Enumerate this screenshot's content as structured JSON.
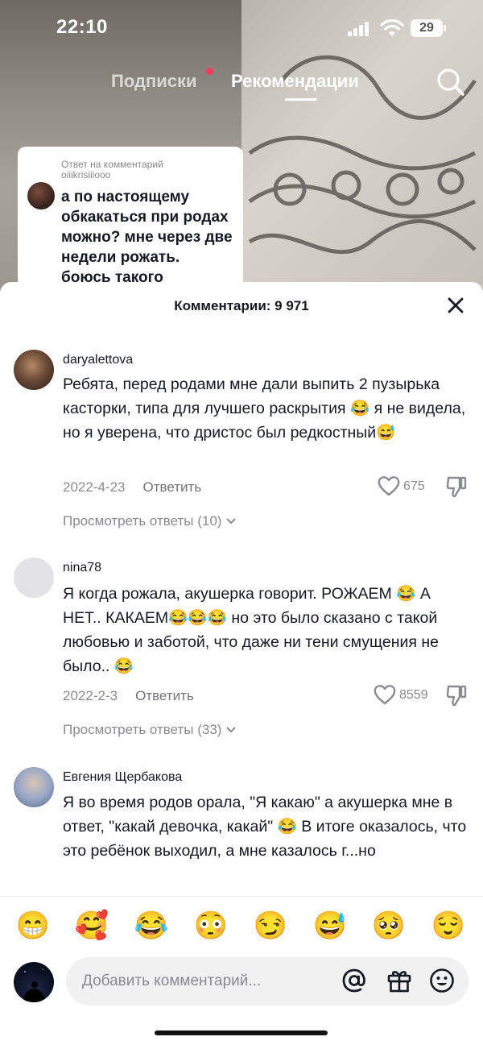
{
  "status_bar": {
    "time": "22:10",
    "battery": "29"
  },
  "top_nav": {
    "following": "Подписки",
    "for_you": "Рекомендации"
  },
  "reply_card": {
    "caption_line1": "Ответ на комментарий",
    "caption_line2": "oiiikrisiiiooo",
    "text": "а по настоящему обкакаться при родах можно? мне через две недели рожать. боюсь такого"
  },
  "sheet": {
    "title": "Комментарии: 9 971"
  },
  "comments": [
    {
      "username": "daryalettova",
      "text": "Ребята, перед родами мне дали выпить 2 пузырька касторки, типа для лучшего раскрытия 😂 я не видела, но я уверена, что дристос был редкостный😅",
      "date": "2022-4-23",
      "reply": "Ответить",
      "likes": "675",
      "view_replies": "Просмотреть ответы (10)"
    },
    {
      "username": "nina78",
      "text": "Я когда рожала, акушерка говорит. РОЖАЕМ 😂 А НЕТ.. КАКАЕМ😂😂😂 но это было сказано с такой любовью и заботой, что даже ни тени смущения не было.. 😂",
      "date": "2022-2-3",
      "reply": "Ответить",
      "likes": "8559",
      "view_replies": "Просмотреть ответы (33)"
    },
    {
      "username": "Евгения Щербакова",
      "text": "Я во время родов орала, \"Я какаю\" а акушерка мне в ответ, \"какай девочка, какай\" 😂 В итоге оказалось, что это ребёнок выходил, а мне казалось г...но"
    }
  ],
  "emoji_bar": [
    "😁",
    "🥰",
    "😂",
    "😳",
    "😏",
    "😅",
    "🥺",
    "😌"
  ],
  "composer": {
    "placeholder": "Добавить комментарий..."
  },
  "colors": {
    "accent_live_dot": "#ff3b5c",
    "text_primary": "#161823",
    "text_secondary": "#8a8b91"
  }
}
